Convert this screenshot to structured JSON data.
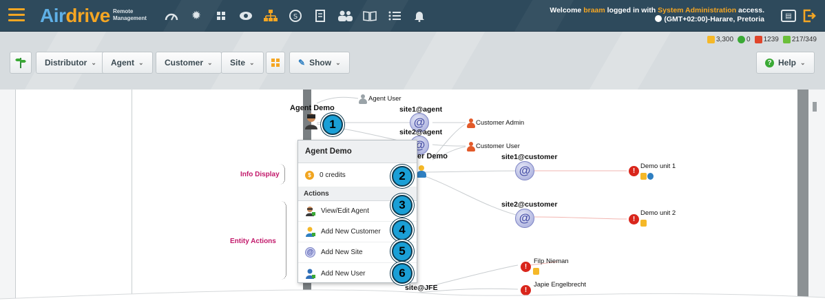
{
  "topbar": {
    "logo_air": "Air",
    "logo_drive": "drive",
    "logo_sub_1": "Remote",
    "logo_sub_2": "Management",
    "welcome_prefix": "Welcome",
    "username": "braam",
    "welcome_mid": "logged in with",
    "access_level": "System Administration",
    "welcome_suffix": "access.",
    "timezone": "(GMT+02:00)-Harare, Pretoria",
    "nav_icons": [
      "dashboard-icon",
      "settings-gear-icon",
      "grid-icon",
      "eye-icon",
      "hierarchy-icon",
      "stop-sign-icon",
      "document-icon",
      "users-icon",
      "book-icon",
      "list-icon",
      "bell-icon"
    ]
  },
  "stats": {
    "units": "3,300",
    "ok": "0",
    "errors": "1239",
    "users": "217/349"
  },
  "toolbar": {
    "distributor": "Distributor",
    "agent": "Agent",
    "customer": "Customer",
    "site": "Site",
    "show": "Show",
    "help": "Help"
  },
  "graph": {
    "agent_user": "Agent User",
    "agent_demo": "Agent Demo",
    "site1_agent": "site1@agent",
    "site2_agent": "site2@agent",
    "customer_admin": "Customer Admin",
    "customer_user": "Customer User",
    "customer_demo_partial": "er Demo",
    "site1_customer": "site1@customer",
    "site2_customer": "site2@customer",
    "demo_unit_1": "Demo unit 1",
    "demo_unit_2": "Demo unit 2",
    "filp_nieman": "Filp Nieman",
    "japie": "Japie Engelbrecht",
    "site_jfe": "site@JFE"
  },
  "popup": {
    "title": "Agent Demo",
    "credits": "0 credits",
    "actions_header": "Actions",
    "actions": [
      "View/Edit Agent",
      "Add New Customer",
      "Add New Site",
      "Add New User"
    ]
  },
  "annotations": {
    "info_display": "Info Display",
    "entity_actions": "Entity Actions",
    "numbers": [
      "1",
      "2",
      "3",
      "4",
      "5",
      "6"
    ]
  },
  "colors": {
    "topbar": "#2e4a5c",
    "accent_orange": "#f5a623",
    "annotation_pink": "#c2186a",
    "callout_blue": "#1a9fd6"
  }
}
